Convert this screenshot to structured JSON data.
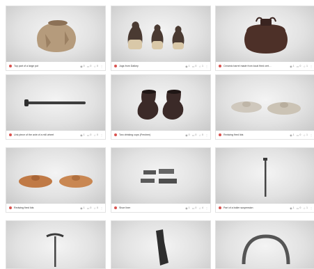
{
  "cards": [
    {
      "title": "Top part of a large pot",
      "views": "0",
      "comments": "0",
      "likes": "0",
      "icon": "pot-fragment"
    },
    {
      "title": "Jugs from Dalkey",
      "views": "1",
      "comments": "0",
      "likes": "1",
      "icon": "jugs"
    },
    {
      "title": "Ceramic barrel made from local fired cert…",
      "views": "1",
      "comments": "0",
      "likes": "1",
      "icon": "barrel"
    },
    {
      "title": "Unk piece of the axle of a mill wheel",
      "views": "1",
      "comments": "0",
      "likes": "0",
      "icon": "axle"
    },
    {
      "title": "Two drinking cups (Frechen)",
      "views": "0",
      "comments": "0",
      "likes": "0",
      "icon": "cups"
    },
    {
      "title": "Redwing fired lids",
      "views": "1",
      "comments": "0",
      "likes": "1",
      "icon": "lids-gray"
    },
    {
      "title": "Redwing fired lids",
      "views": "1",
      "comments": "0",
      "likes": "0",
      "icon": "lids-orange"
    },
    {
      "title": "Shoe liner",
      "views": "1",
      "comments": "0",
      "likes": "4",
      "icon": "shoe-liner"
    },
    {
      "title": "Part of a boiler suspension",
      "views": "1",
      "comments": "0",
      "likes": "1",
      "icon": "spike"
    },
    {
      "title": "",
      "views": "",
      "comments": "",
      "likes": "",
      "icon": "pick"
    },
    {
      "title": "",
      "views": "",
      "comments": "",
      "likes": "",
      "icon": "blade"
    },
    {
      "title": "",
      "views": "",
      "comments": "",
      "likes": "",
      "icon": "horseshoe-arch"
    }
  ]
}
